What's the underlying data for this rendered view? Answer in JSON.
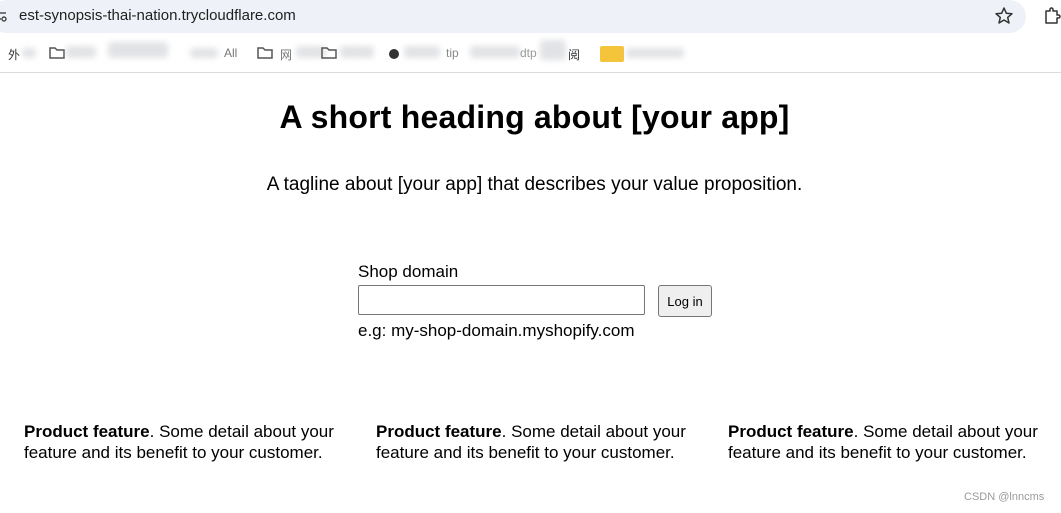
{
  "browser": {
    "url": "est-synopsis-thai-nation.trycloudflare.com",
    "bookmarks": [
      "外",
      "All",
      "网",
      "tip",
      "dtp",
      "阅"
    ]
  },
  "page": {
    "heading": "A short heading about [your app]",
    "tagline": "A tagline about [your app] that describes your value proposition.",
    "form": {
      "label": "Shop domain",
      "input_value": "",
      "button": "Log in",
      "help": "e.g: my-shop-domain.myshopify.com"
    },
    "features": [
      {
        "title": "Product feature",
        "detail": ". Some detail about your feature and its benefit to your customer."
      },
      {
        "title": "Product feature",
        "detail": ". Some detail about your feature and its benefit to your customer."
      },
      {
        "title": "Product feature",
        "detail": ". Some detail about your feature and its benefit to your customer."
      }
    ]
  },
  "watermark": "CSDN @lnncms"
}
